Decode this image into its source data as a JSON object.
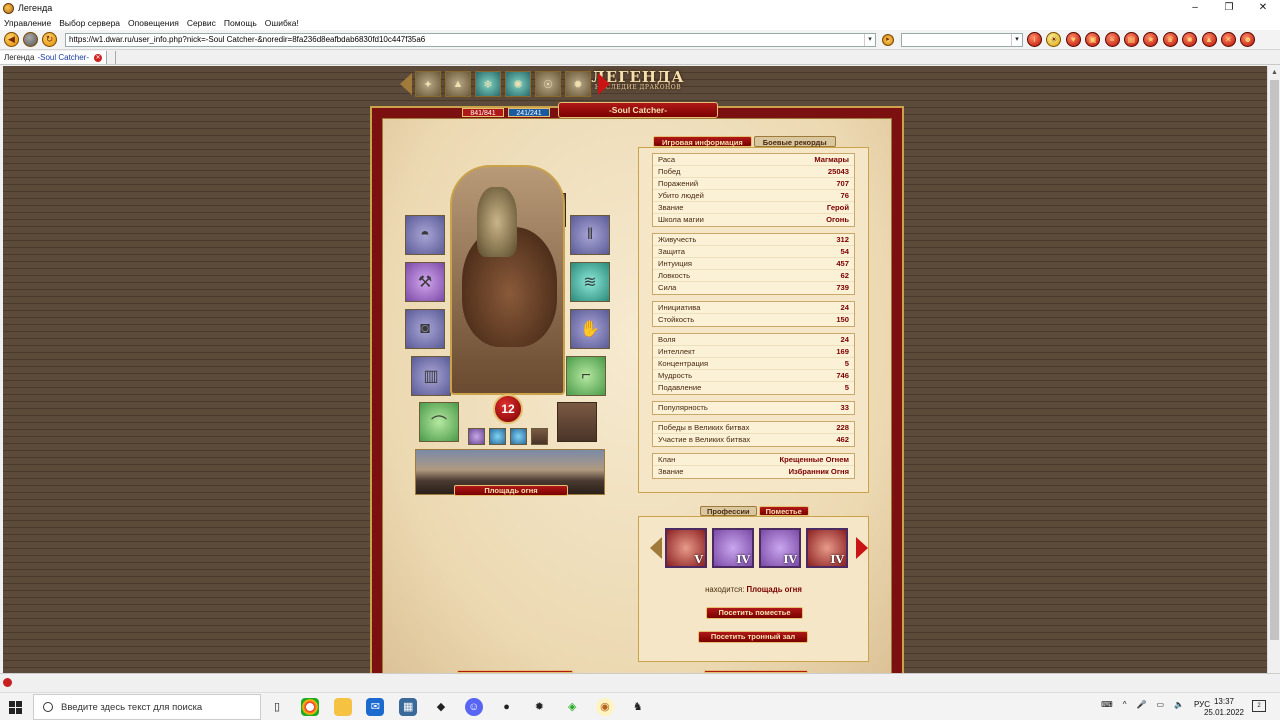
{
  "window": {
    "title": "Легенда",
    "controls": [
      "–",
      "❐",
      "✕"
    ]
  },
  "menu": [
    "Управление",
    "Выбор сервера",
    "Оповещения",
    "Сервис",
    "Помощь",
    "Ошибка!"
  ],
  "address": {
    "url": "https://w1.dwar.ru/user_info.php?nick=-Soul Catcher-&noredir=8fa236d8eafbdab6830fd10c447f35a6"
  },
  "tabs": {
    "label": "Легенда",
    "name": "-Soul Catcher-"
  },
  "game": {
    "logo": "ЛЕГЕНДА",
    "logo_sub": "НАСЛЕДИЕ ДРАКОНОВ",
    "nickname": "-Soul Catcher-",
    "hp": "841/841",
    "mp": "241/241",
    "level": "12",
    "location": "Площадь огня",
    "info_tabs": {
      "active": "Игровая информация",
      "other": "Боевые рекорды"
    },
    "stats_groups": [
      [
        {
          "k": "Раса",
          "v": "Магмары"
        },
        {
          "k": "Побед",
          "v": "25043"
        },
        {
          "k": "Поражений",
          "v": "707"
        },
        {
          "k": "Убито людей",
          "v": "76"
        },
        {
          "k": "Звание",
          "v": "Герой"
        },
        {
          "k": "Школа магии",
          "v": "Огонь"
        }
      ],
      [
        {
          "k": "Живучесть",
          "v": "312"
        },
        {
          "k": "Защита",
          "v": "54"
        },
        {
          "k": "Интуиция",
          "v": "457"
        },
        {
          "k": "Ловкость",
          "v": "62"
        },
        {
          "k": "Сила",
          "v": "739"
        }
      ],
      [
        {
          "k": "Инициатива",
          "v": "24"
        },
        {
          "k": "Стойкость",
          "v": "150"
        }
      ],
      [
        {
          "k": "Воля",
          "v": "24"
        },
        {
          "k": "Интеллект",
          "v": "169"
        },
        {
          "k": "Концентрация",
          "v": "5"
        },
        {
          "k": "Мудрость",
          "v": "746"
        },
        {
          "k": "Подавление",
          "v": "5"
        }
      ],
      [
        {
          "k": "Популярность",
          "v": "33"
        }
      ],
      [
        {
          "k": "Победы в Великих битвах",
          "v": "228"
        },
        {
          "k": "Участие в Великих битвах",
          "v": "462"
        }
      ],
      [
        {
          "k": "Клан",
          "v": "Крещенные Огнем"
        },
        {
          "k": "Звание",
          "v": "Избранник Огня"
        }
      ]
    ],
    "estate_tabs": {
      "other": "Профессии",
      "active": "Поместье"
    },
    "estate_levels": [
      "V",
      "IV",
      "IV",
      "IV"
    ],
    "located_label": "находится:",
    "located_value": "Площадь огня",
    "visit_estate": "Посетить поместье",
    "visit_throne": "Посетить тронный зал"
  },
  "taskbar": {
    "search_placeholder": "Введите здесь текст для поиска",
    "lang": "РУС",
    "time": "13:37",
    "date": "25.01.2022",
    "notifications": "2"
  }
}
